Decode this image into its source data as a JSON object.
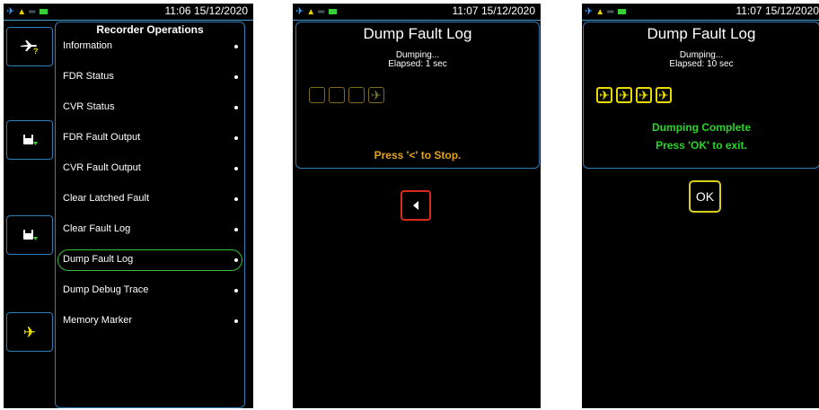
{
  "screens": [
    {
      "clock": "11:06 15/12/2020",
      "menu_title": "Recorder Operations",
      "menu_items": [
        "Information",
        "FDR Status",
        "CVR Status",
        "FDR Fault Output",
        "CVR Fault Output",
        "Clear Latched Fault",
        "Clear Fault Log",
        "Dump Fault Log",
        "Dump Debug Trace",
        "Memory Marker"
      ],
      "selected_item": "Dump Fault Log",
      "side_buttons": [
        "aircraft-help-icon",
        "save-to-device-icon",
        "save-to-device-icon",
        "aircraft-icon"
      ]
    },
    {
      "clock": "11:07 15/12/2020",
      "title": "Dump Fault Log",
      "status": "Dumping...",
      "elapsed": "Elapsed: 1 sec",
      "progress_done": 0,
      "progress_total": 4,
      "message": "Press '<' to Stop.",
      "button": "back-arrow-icon"
    },
    {
      "clock": "11:07 15/12/2020",
      "title": "Dump Fault Log",
      "status": "Dumping...",
      "elapsed": "Elapsed: 10 sec",
      "progress_done": 4,
      "progress_total": 4,
      "message_line1": "Dumping Complete",
      "message_line2": "Press 'OK' to exit.",
      "ok_label": "OK"
    }
  ],
  "icons": {
    "plane": "✈",
    "warning": "▲",
    "link": "═"
  },
  "colors": {
    "accent_border": "#2f7fb8",
    "selected_outline": "#3bbd3b",
    "stop_text": "#e3a21d",
    "complete_text": "#28d628",
    "progress_done": "#e8dc00",
    "stop_button": "#d82a1c",
    "ok_button": "#d8cf20"
  }
}
